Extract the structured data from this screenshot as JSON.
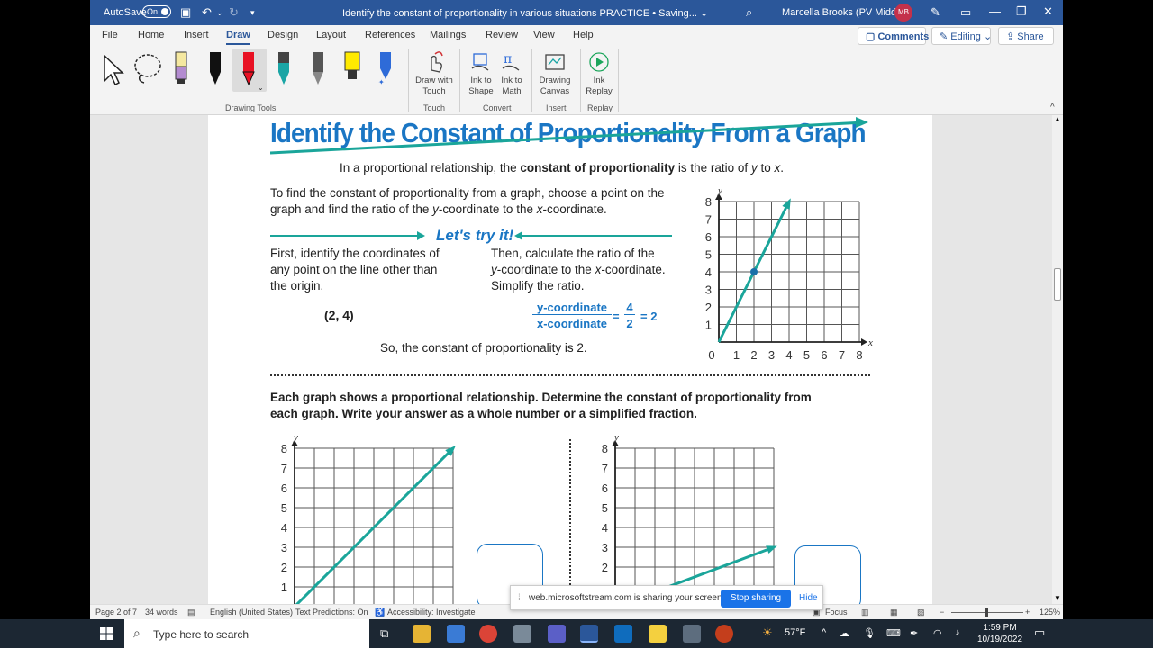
{
  "titlebar": {
    "autosave_label": "AutoSave",
    "autosave_state": "On",
    "document_title": "Identify the constant of proportionality in various situations PRACTICE • Saving... ⌄",
    "user_name": "Marcella Brooks (PV Middle)",
    "user_initials": "MB"
  },
  "menu": {
    "items": [
      "File",
      "Home",
      "Insert",
      "Draw",
      "Design",
      "Layout",
      "References",
      "Mailings",
      "Review",
      "View",
      "Help"
    ],
    "comments": "Comments",
    "editing": "Editing",
    "share": "Share"
  },
  "ribbon": {
    "drawing_tools_label": "Drawing Tools",
    "draw_with_touch": [
      "Draw with",
      "Touch"
    ],
    "touch_label": "Touch",
    "ink_to_shape": [
      "Ink to",
      "Shape"
    ],
    "ink_to_math": [
      "Ink to",
      "Math"
    ],
    "convert_label": "Convert",
    "drawing_canvas": [
      "Drawing",
      "Canvas"
    ],
    "insert_label": "Insert",
    "ink_replay": [
      "Ink",
      "Replay"
    ],
    "replay_label": "Replay",
    "colors": {
      "highlighter_purple": "#b38bd0",
      "pen_red": "#e81123",
      "pen_teal": "#1aa5a5",
      "pen_gray": "#666666",
      "highlighter_yellow": "#ffea00",
      "pen_blue": "#2e6bd8"
    }
  },
  "document": {
    "heading": "Identify the Constant of Proportionality From a Graph",
    "intro_pre": "In a proportional relationship, the ",
    "intro_bold": "constant of proportionality",
    "intro_post": " is the ratio of ",
    "intro_y": "y",
    "intro_to": " to ",
    "intro_x": "x",
    "intro_end": ".",
    "find_line1": "To find the constant of proportionality from a graph, choose a point on the",
    "find_line2_a": "graph and find the ratio of the ",
    "find_line2_y": "y",
    "find_line2_b": "-coordinate to the ",
    "find_line2_x": "x",
    "find_line2_c": "-coordinate.",
    "lets_try": "Let's try it!",
    "first_lines": [
      "First, identify the coordinates of",
      "any point on the line other than",
      "the origin."
    ],
    "then_line1": "Then, calculate the ratio of the",
    "then_line2_y": "y",
    "then_line2_a": "-coordinate to the ",
    "then_line2_x": "x",
    "then_line2_b": "-coordinate.",
    "then_line3": "Simplify the ratio.",
    "point": "(2, 4)",
    "frac_num": "y-coordinate",
    "frac_den": "x-coordinate",
    "frac_eq": "=",
    "frac_n": "4",
    "frac_d": "2",
    "frac_result": "= 2",
    "conclusion": "So, the constant of proportionality is 2.",
    "instructions_line1": "Each graph shows a proportional relationship. Determine the constant of proportionality from",
    "instructions_line2": "each graph. Write your answer as a whole number or a simplified fraction.",
    "graph_axis_y": "y",
    "graph_axis_x": "x",
    "accent_color": "#1aa59a",
    "heading_color": "#1a76c4"
  },
  "chart_data": [
    {
      "type": "line",
      "x": [
        0,
        4
      ],
      "y": [
        0,
        8
      ],
      "highlighted_point": [
        2,
        4
      ],
      "xticks": [
        0,
        1,
        2,
        3,
        4,
        5,
        6,
        7,
        8
      ],
      "yticks": [
        1,
        2,
        3,
        4,
        5,
        6,
        7,
        8
      ],
      "xlim": [
        0,
        8
      ],
      "ylim": [
        0,
        8
      ],
      "xlabel": "x",
      "ylabel": "y",
      "grid": true
    },
    {
      "type": "line",
      "x": [
        0,
        8
      ],
      "y": [
        0,
        8
      ],
      "yticks": [
        1,
        2,
        3,
        4,
        5,
        6,
        7,
        8
      ],
      "xlim": [
        0,
        8
      ],
      "ylim": [
        0,
        8
      ],
      "ylabel": "y",
      "grid": true
    },
    {
      "type": "line",
      "x": [
        0,
        8
      ],
      "y": [
        0,
        3
      ],
      "yticks": [
        2,
        3,
        4,
        5,
        6,
        7,
        8
      ],
      "xlim": [
        0,
        8
      ],
      "ylim": [
        0,
        8
      ],
      "ylabel": "y",
      "grid": true
    }
  ],
  "statusbar": {
    "page": "Page 2 of 7",
    "words": "34 words",
    "language": "English (United States)",
    "predictions": "Text Predictions: On",
    "accessibility": "Accessibility: Investigate",
    "focus": "Focus",
    "zoom": "125%"
  },
  "sharebar": {
    "message": "web.microsoftstream.com is sharing your screen.",
    "stop": "Stop sharing",
    "hide": "Hide"
  },
  "taskbar": {
    "search_placeholder": "Type here to search",
    "weather": "57°F",
    "time": "1:59 PM",
    "date": "10/19/2022"
  }
}
